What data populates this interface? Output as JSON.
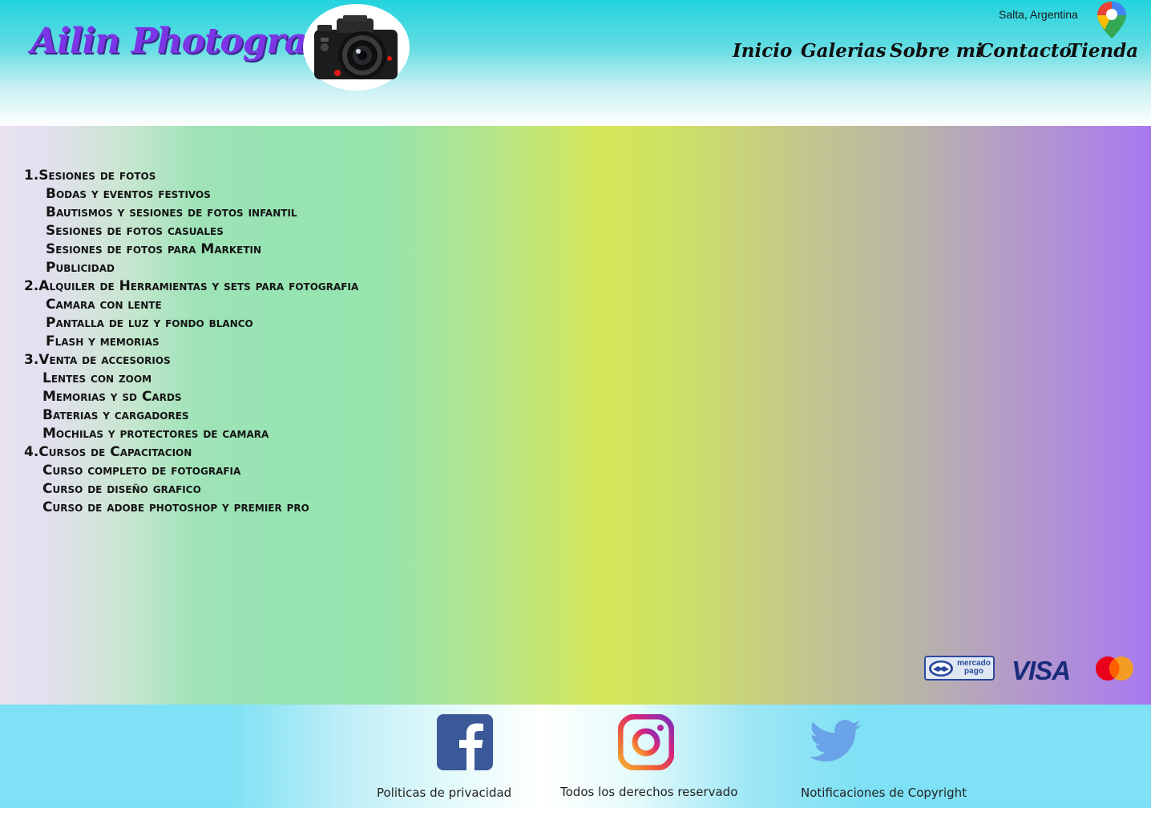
{
  "header": {
    "brand": "Ailin Photografh",
    "location": "Salta, Argentina",
    "camera_icon": "camera-icon",
    "pin_icon": "map-pin-icon",
    "nav": [
      {
        "label": "Inicio"
      },
      {
        "label": "Galerias"
      },
      {
        "label": "Sobre mi"
      },
      {
        "label": "Contacto"
      },
      {
        "label": "Tienda"
      }
    ]
  },
  "services": [
    {
      "label": "1.Sesiones de fotos",
      "level": "category"
    },
    {
      "label": "Bodas y eventos festivos",
      "level": "a"
    },
    {
      "label": "Bautismos y sesiones de fotos infantil",
      "level": "a"
    },
    {
      "label": "Sesiones de fotos casuales",
      "level": "a"
    },
    {
      "label": "Sesiones de fotos para Marketin",
      "level": "a"
    },
    {
      "label": "Publicidad",
      "level": "a"
    },
    {
      "label": "2.Alquiler de Herramientas y sets para fotografia",
      "level": "category"
    },
    {
      "label": "Camara con lente",
      "level": "a"
    },
    {
      "label": "Pantalla de luz y fondo blanco",
      "level": "a"
    },
    {
      "label": "Flash y memorias",
      "level": "a"
    },
    {
      "label": "3.Venta de accesorios",
      "level": "category"
    },
    {
      "label": "Lentes con zoom",
      "level": "b"
    },
    {
      "label": "Memorias y sd Cards",
      "level": "b"
    },
    {
      "label": "Baterias y cargadores",
      "level": "b"
    },
    {
      "label": "Mochilas y protectores de camara",
      "level": "b"
    },
    {
      "label": "4.Cursos de Capacitacion",
      "level": "category"
    },
    {
      "label": "Curso completo de fotografia",
      "level": "b"
    },
    {
      "label": "Curso de diseño grafico",
      "level": "b"
    },
    {
      "label": "Curso de adobe photoshop y premier pro",
      "level": "b"
    }
  ],
  "payments": {
    "mercadopago": "mercado pago",
    "visa": "VISA",
    "mastercard_icon": "mastercard-icon"
  },
  "footer": {
    "social": [
      "facebook-icon",
      "instagram-icon",
      "twitter-icon"
    ],
    "links": [
      {
        "label": "Politicas de privacidad"
      },
      {
        "label": "Todos los derechos reservado"
      },
      {
        "label": "Notificaciones de Copyright"
      }
    ]
  },
  "colors": {
    "brand": "#7b35e6",
    "header_top": "#22d3de",
    "footer_bg": "#7ee1f5",
    "facebook": "#3b5998",
    "twitter": "#6aa3e8"
  }
}
